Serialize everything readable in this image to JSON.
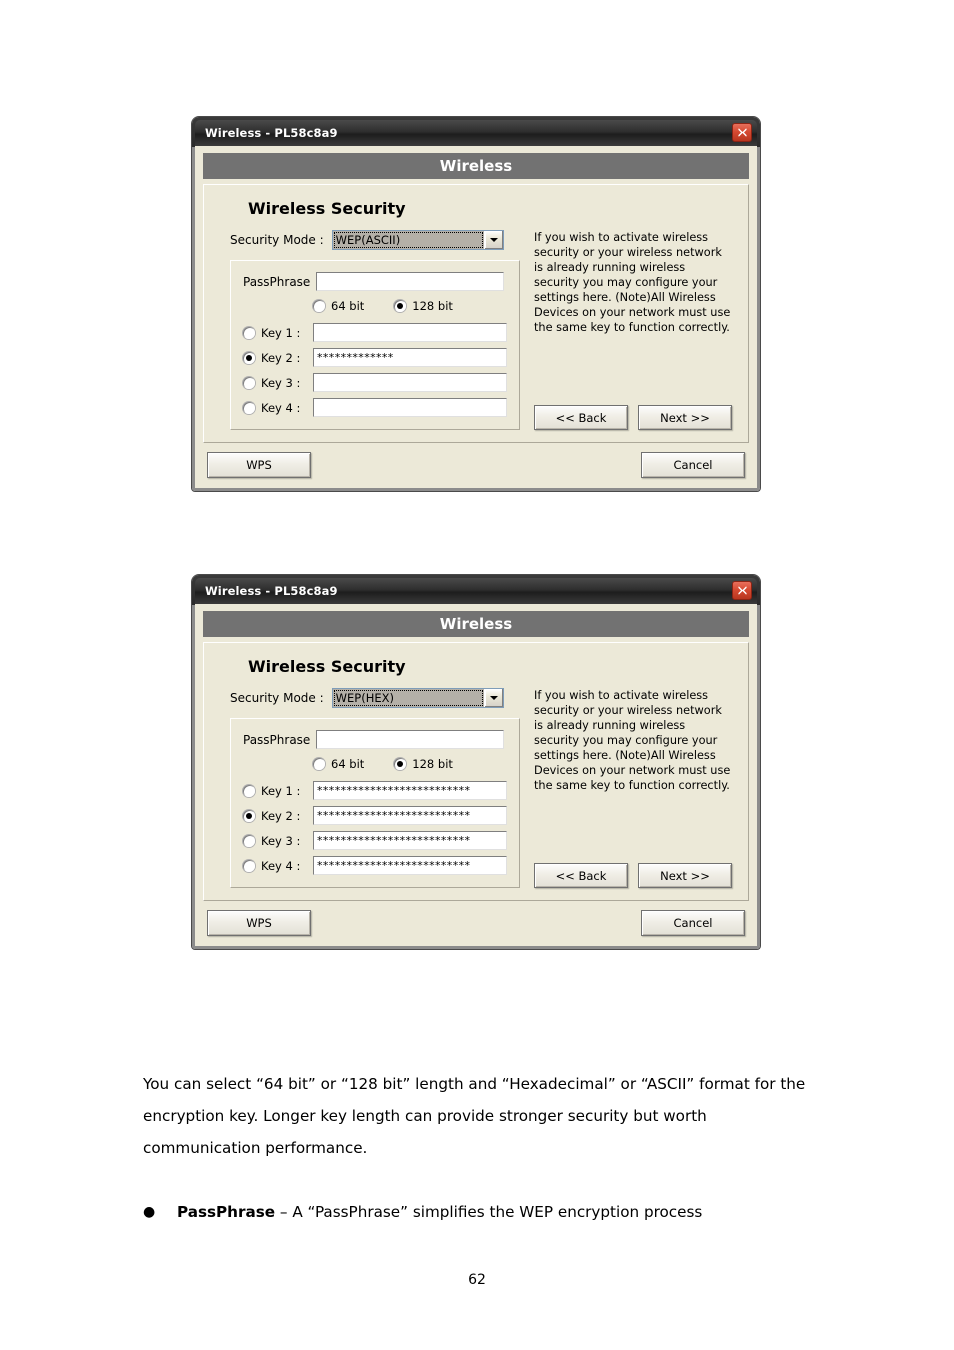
{
  "document": {
    "page_number": "62",
    "paragraph": "You can select “64 bit” or “128 bit” length and “Hexadecimal” or “ASCII” format for the encryption key. Longer key length can provide stronger security but worth communication performance.",
    "bullet": {
      "marker": "●",
      "term": "PassPhrase",
      "rest": " – A “PassPhrase” simplifies the WEP encryption process"
    }
  },
  "common": {
    "window_title": "Wireless - PL58c8a9",
    "banner": "Wireless",
    "panel_heading": "Wireless Security",
    "security_mode_label": "Security Mode :",
    "passphrase_label": "PassPhrase",
    "passphrase_value": "",
    "bit_64_label": "64 bit",
    "bit_128_label": "128 bit",
    "key_labels": [
      "Key 1 :",
      "Key 2 :",
      "Key 3 :",
      "Key 4 :"
    ],
    "help_text": "If you wish to activate wireless security or your wireless network is already running wireless security you may configure your settings here. (Note)All Wireless Devices on your network must use the same key to function correctly.",
    "back_label": "<< Back",
    "next_label": "Next >>",
    "wps_label": "WPS",
    "cancel_label": "Cancel",
    "close_icon": "close-icon",
    "dropdown_icon": "chevron-down-icon",
    "colors": {
      "titlebar": "#2e2e2e",
      "banner": "#727272",
      "dialog_face": "#ece9d8",
      "close_button": "#d64a32",
      "combo_field": "#b4b0a8"
    }
  },
  "dialog1": {
    "security_mode_value": "WEP(ASCII)",
    "bit_selected": "128 bit",
    "selected_key_index": 1,
    "key_values": [
      "",
      "*************",
      "",
      ""
    ]
  },
  "dialog2": {
    "security_mode_value": "WEP(HEX)",
    "bit_selected": "128 bit",
    "selected_key_index": 1,
    "key_values": [
      "**************************",
      "**************************",
      "**************************",
      "**************************"
    ]
  }
}
